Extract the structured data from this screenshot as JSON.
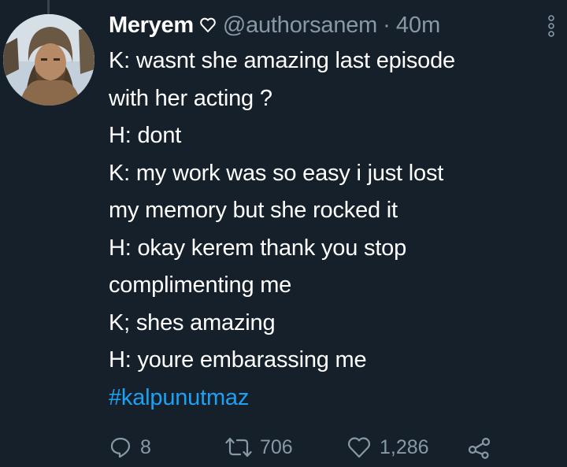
{
  "tweet": {
    "author": {
      "display_name": "Meryem",
      "badge_icon": "heart-outline-icon",
      "handle": "@authorsanem",
      "separator": "·",
      "time": "40m"
    },
    "lines": [
      "K: wasnt she amazing last episode",
      "with her acting ?",
      "H: dont",
      "K: my work was so easy i just lost",
      "my memory but she rocked it",
      "H: okay kerem thank you stop",
      "complimenting me",
      "K; shes amazing",
      "H: youre embarassing me"
    ],
    "hashtag": "#kalpunutmaz",
    "actions": {
      "reply_count": "8",
      "retweet_count": "706",
      "like_count": "1,286"
    }
  },
  "colors": {
    "background": "#15202b",
    "text": "#ffffff",
    "secondary": "#8899a6",
    "link": "#1da1f2"
  }
}
